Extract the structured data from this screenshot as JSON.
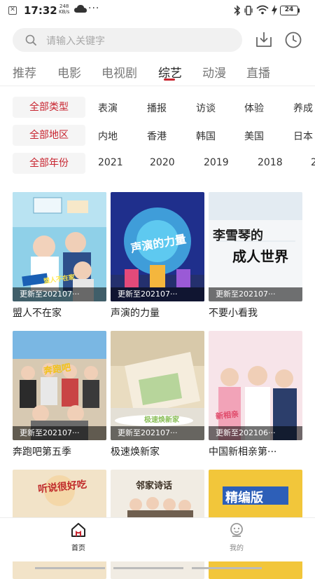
{
  "status_bar": {
    "time": "17:32",
    "speed_value": "248",
    "speed_unit": "KB/s",
    "more": "···",
    "battery": "24"
  },
  "search": {
    "placeholder": "请输入关键字"
  },
  "tabs": [
    {
      "label": "推荐"
    },
    {
      "label": "电影"
    },
    {
      "label": "电视剧"
    },
    {
      "label": "综艺",
      "active": true
    },
    {
      "label": "动漫"
    },
    {
      "label": "直播"
    }
  ],
  "filters": {
    "type": {
      "all_label": "全部类型",
      "options": [
        "表演",
        "播报",
        "访谈",
        "体验",
        "养成"
      ]
    },
    "region": {
      "all_label": "全部地区",
      "options": [
        "内地",
        "香港",
        "韩国",
        "美国",
        "日本"
      ]
    },
    "year": {
      "all_label": "全部年份",
      "options": [
        "2021",
        "2020",
        "2019",
        "2018",
        "2"
      ]
    }
  },
  "shows": [
    {
      "title": "盟人不在家",
      "badge": "更新至202107···",
      "poster_text": "盟人不在家"
    },
    {
      "title": "声演的力量",
      "badge": "更新至202107···",
      "poster_text": "声演的力量"
    },
    {
      "title": "不要小看我",
      "badge": "更新至202107···",
      "poster_text_1": "李雪琴的",
      "poster_text_2": "成人世界"
    },
    {
      "title": "奔跑吧第五季",
      "badge": "更新至202107···",
      "poster_text": "奔跑吧"
    },
    {
      "title": "极速焕新家",
      "badge": "更新至202107···",
      "poster_text": "极速焕新家"
    },
    {
      "title": "中国新相亲第···",
      "badge": "更新至202106···",
      "poster_text": "新相亲"
    },
    {
      "title": "",
      "badge": "",
      "poster_text": "听说很好吃"
    },
    {
      "title": "",
      "badge": "",
      "poster_text": "邻家诗话"
    },
    {
      "title": "",
      "badge": "",
      "poster_text": "精编版"
    }
  ],
  "bottom_nav": [
    {
      "label": "首页",
      "icon": "home-icon",
      "active": true
    },
    {
      "label": "我的",
      "icon": "profile-icon",
      "active": false
    }
  ],
  "colors": {
    "accent": "#c8242f",
    "chip_bg": "#f5f5f5",
    "search_bg": "#f1f1f1"
  }
}
